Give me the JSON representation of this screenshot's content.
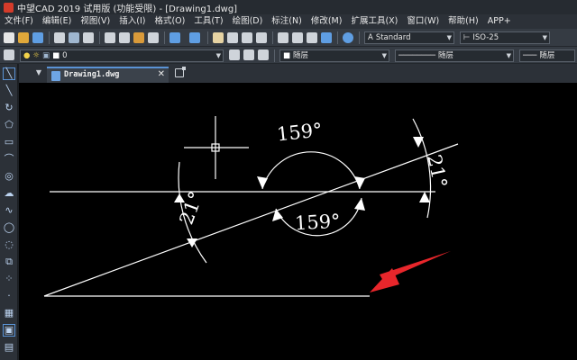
{
  "window": {
    "title": "中望CAD 2019 试用版 (功能受限) - [Drawing1.dwg]"
  },
  "menu": {
    "items": [
      "文件(F)",
      "编辑(E)",
      "视图(V)",
      "插入(I)",
      "格式(O)",
      "工具(T)",
      "绘图(D)",
      "标注(N)",
      "修改(M)",
      "扩展工具(X)",
      "窗口(W)",
      "帮助(H)",
      "APP+"
    ]
  },
  "toolbar": {
    "text_style": "Standard",
    "dim_style": "ISO-25",
    "layer": "0",
    "color": "随层",
    "linetype": "随层",
    "lineweight": "随层"
  },
  "tabs": {
    "active": "Drawing1.dwg",
    "close_glyph": "✕"
  },
  "drawing": {
    "dim_labels": [
      "159°",
      "159°",
      "21°",
      "21°"
    ]
  },
  "colors": {
    "canvas_bg": "#000000",
    "geometry": "#ffffff",
    "annotation_arrow": "#e8262b",
    "ui_chrome": "#353b43",
    "tab_accent": "#5a93d6"
  }
}
